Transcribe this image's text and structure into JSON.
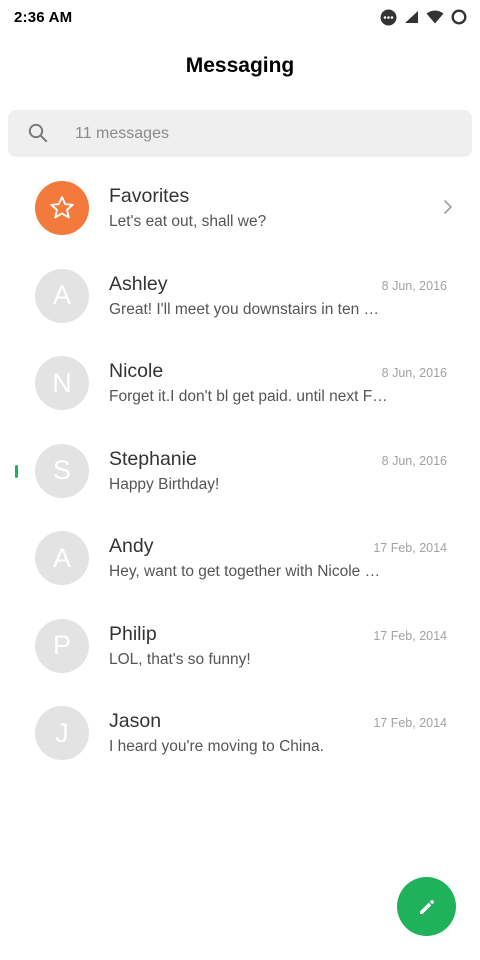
{
  "status_bar": {
    "time": "2:36 AM",
    "icons": [
      "notification-dot-icon",
      "signal-icon",
      "wifi-icon",
      "battery-circle-icon"
    ]
  },
  "header": {
    "title": "Messaging"
  },
  "search": {
    "placeholder": "11 messages",
    "icon": "search-icon"
  },
  "favorites": {
    "name": "Favorites",
    "snippet": "Let's eat out, shall we?",
    "icon": "star-icon",
    "color": "#f47a3c"
  },
  "conversations": [
    {
      "initial": "A",
      "name": "Ashley",
      "date": "8 Jun, 2016",
      "snippet": "Great! I'll meet you downstairs in ten …",
      "unread": false
    },
    {
      "initial": "N",
      "name": "Nicole",
      "date": "8 Jun, 2016",
      "snippet": "Forget it.I don't bl get paid. until next F…",
      "unread": false
    },
    {
      "initial": "S",
      "name": "Stephanie",
      "date": "8 Jun, 2016",
      "snippet": "Happy Birthday!",
      "unread": true
    },
    {
      "initial": "A",
      "name": "Andy",
      "date": "17 Feb, 2014",
      "snippet": "Hey, want to get together with Nicole …",
      "unread": false
    },
    {
      "initial": "P",
      "name": "Philip",
      "date": "17 Feb, 2014",
      "snippet": "LOL, that's so funny!",
      "unread": false
    },
    {
      "initial": "J",
      "name": "Jason",
      "date": "17 Feb, 2014",
      "snippet": "I heard you're moving to China.",
      "unread": false
    }
  ],
  "fab": {
    "icon": "pencil-icon",
    "color": "#1fb25a"
  },
  "colors": {
    "accent": "#1fb25a",
    "avatar_bg": "#e3e3e3",
    "favorites": "#f47a3c"
  }
}
